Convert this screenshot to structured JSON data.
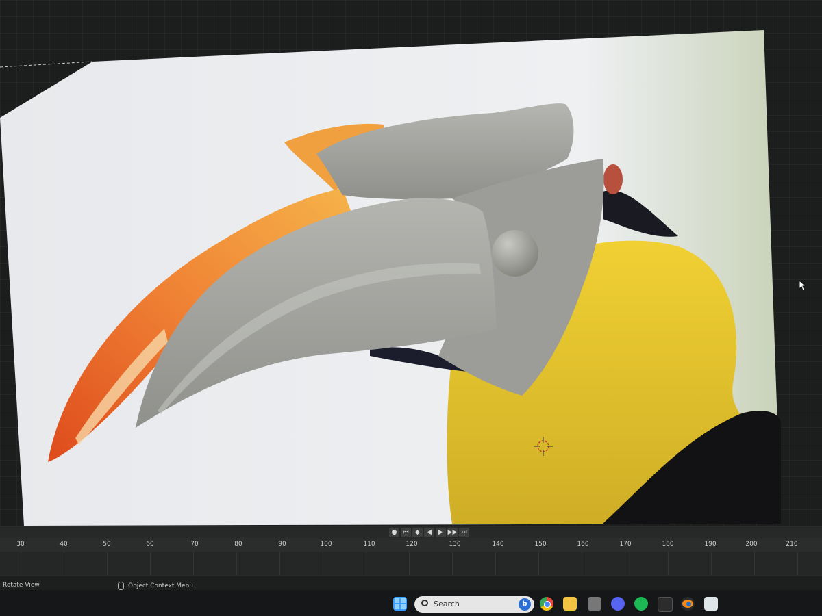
{
  "timeline": {
    "playback_controls": [
      "●",
      "⏮",
      "◆",
      "◀",
      "▶",
      "▶▶",
      "⏭"
    ],
    "frame_ticks": [
      "30",
      "40",
      "50",
      "60",
      "70",
      "80",
      "90",
      "100",
      "110",
      "120",
      "130",
      "140",
      "150",
      "160",
      "170",
      "180",
      "190",
      "200",
      "210"
    ]
  },
  "status": {
    "left_label": "Rotate View",
    "mid_label": "Object Context Menu"
  },
  "taskbar": {
    "search_placeholder": "Search",
    "bing_letter": "b"
  },
  "colors": {
    "beak_orange": "#e8692a",
    "casque_yellow": "#f2a23a",
    "feather_yellow": "#e2c329",
    "model_gray": "#a3a49f"
  }
}
